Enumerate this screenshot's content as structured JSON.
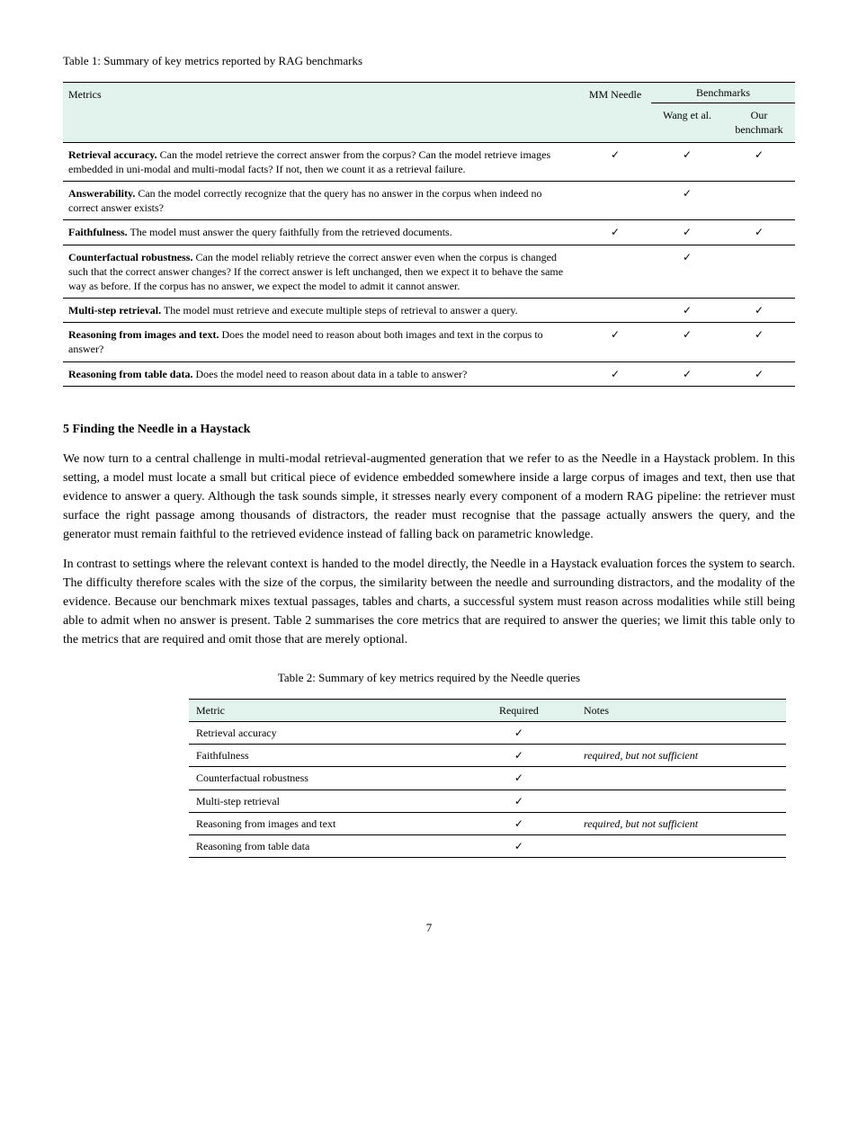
{
  "table1": {
    "caption_label": "Table 1:",
    "caption_text": " Summary of key metrics reported by RAG benchmarks",
    "headers": {
      "metric": "Metrics",
      "mm": "MM Needle",
      "benchmarks": "Benchmarks",
      "congolese": "Wang et al.",
      "our": "Our benchmark"
    },
    "rows": [
      {
        "metric": "<b>Retrieval accuracy.</b> Can the model retrieve the correct answer from the corpus? Can the model retrieve images embedded in uni-modal and multi-modal facts? If not, then we count it as a retrieval failure.",
        "mm": true,
        "congo": true,
        "our": true
      },
      {
        "metric": "<b>Answerability.</b> Can the model correctly recognize that the query has no answer in the corpus when indeed no correct answer exists?",
        "mm": false,
        "congo": true,
        "our": false
      },
      {
        "metric": "<b>Faithfulness.</b> The model must answer the query faithfully from the retrieved documents.",
        "mm": true,
        "congo": true,
        "our": true
      },
      {
        "metric": "<b>Counterfactual robustness.</b> Can the model reliably retrieve the correct answer even when the corpus is changed such that the correct answer changes? If the correct answer is left unchanged, then we expect it to behave the same way as before. If the corpus has no answer, we expect the model to admit it cannot answer.",
        "mm": false,
        "congo": true,
        "our": false
      },
      {
        "metric": "<b>Multi-step retrieval.</b> The model must retrieve and execute multiple steps of retrieval to answer a query.",
        "mm": false,
        "congo": true,
        "our": true
      },
      {
        "metric": "<b>Reasoning from images and text.</b> Does the model need to reason about both images and text in the corpus to answer?",
        "mm": true,
        "congo": true,
        "our": true
      },
      {
        "metric": "<b>Reasoning from table data.</b> Does the model need to reason about data in a table to answer?",
        "mm": true,
        "congo": true,
        "our": true
      }
    ]
  },
  "section5": {
    "heading": "5 Finding the Needle in a Haystack",
    "para1": "We now turn to a central challenge in multi-modal retrieval-augmented generation that we refer to as the Needle in a Haystack problem. In this setting, a model must locate a small but critical piece of evidence embedded somewhere inside a large corpus of images and text, then use that evidence to answer a query. Although the task sounds simple, it stresses nearly every component of a modern RAG pipeline: the retriever must surface the right passage among thousands of distractors, the reader must recognise that the passage actually answers the query, and the generator must remain faithful to the retrieved evidence instead of falling back on parametric knowledge.",
    "para2": "In contrast to settings where the relevant context is handed to the model directly, the Needle in a Haystack evaluation forces the system to search. The difficulty therefore scales with the size of the corpus, the similarity between the needle and surrounding distractors, and the modality of the evidence. Because our benchmark mixes textual passages, tables and charts, a successful system must reason across modalities while still being able to admit when no answer is present. Table 2 summarises the core metrics that are required to answer the queries; we limit this table only to the metrics that are required and omit those that are merely optional."
  },
  "table2": {
    "caption_label": "Table 2:",
    "caption_text": " Summary of key metrics required by the Needle queries",
    "headers": {
      "metric": "Metric",
      "required": "Required",
      "notes": "Notes"
    },
    "rows": [
      {
        "metric": "Retrieval accuracy",
        "required": true,
        "notes": ""
      },
      {
        "metric": "Faithfulness",
        "required": true,
        "notes": "<span class='ital'>required, but not sufficient</span>"
      },
      {
        "metric": "Counterfactual robustness",
        "required": true,
        "notes": ""
      },
      {
        "metric": "Multi-step retrieval",
        "required": true,
        "notes": ""
      },
      {
        "metric": "Reasoning from images and text",
        "required": true,
        "notes": "<span class='ital'>required, but not sufficient</span>"
      },
      {
        "metric": "Reasoning from table data",
        "required": true,
        "notes": ""
      }
    ]
  },
  "page_number": "7",
  "checkmark": "✓"
}
